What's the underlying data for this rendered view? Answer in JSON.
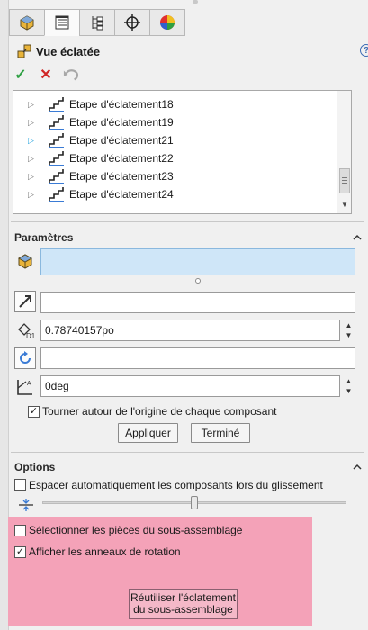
{
  "panel": {
    "title": "Vue éclatée",
    "help_glyph": "?",
    "tabs": [
      "feature-manager-icon",
      "property-manager-icon",
      "configuration-manager-icon",
      "dimxpert-icon",
      "display-manager-icon"
    ]
  },
  "actions": {
    "ok": "✓",
    "cancel": "✕"
  },
  "tree": {
    "items": [
      {
        "label": "Etape d'éclatement18"
      },
      {
        "label": "Etape d'éclatement19"
      },
      {
        "label": "Etape d'éclatement21"
      },
      {
        "label": "Etape d'éclatement22"
      },
      {
        "label": "Etape d'éclatement23"
      },
      {
        "label": "Etape d'éclatement24"
      }
    ]
  },
  "parametres": {
    "header": "Paramètres",
    "components_value": "",
    "direction_value": "",
    "distance_value": "0.78740157po",
    "rotation_axis_value": "",
    "angle_value": "0deg",
    "rotate_origin_label": "Tourner autour de l'origine de chaque composant",
    "rotate_origin_checked": true,
    "apply_label": "Appliquer",
    "done_label": "Terminé"
  },
  "options": {
    "header": "Options",
    "auto_space_label": "Espacer automatiquement les composants lors du glissement",
    "auto_space_checked": false,
    "spacing_level": 0.5,
    "select_subassembly_parts_label": "Sélectionner les pièces du sous-assemblage",
    "select_subassembly_parts_checked": false,
    "show_rotation_rings_label": "Afficher les anneaux de rotation",
    "show_rotation_rings_checked": true,
    "reuse_explode_line1": "Réutiliser l'éclatement",
    "reuse_explode_line2": "du sous-assemblage"
  },
  "colors": {
    "selection_field": "#cfe6f8",
    "highlight_panel": "#f4a2b8",
    "accept_green": "#2ea043",
    "cancel_red": "#d02626"
  }
}
